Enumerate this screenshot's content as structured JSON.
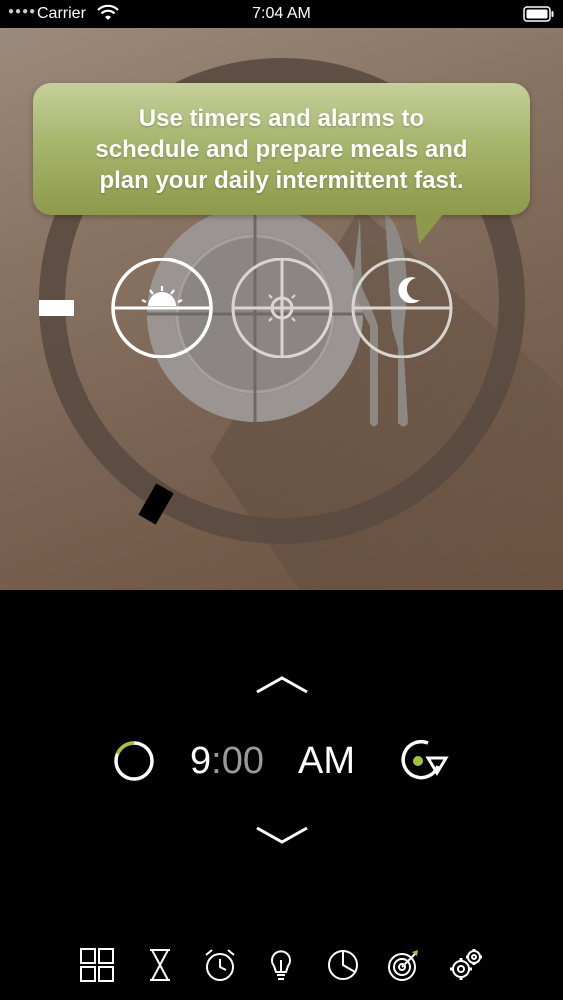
{
  "status_bar": {
    "carrier": "Carrier",
    "time": "7:04 AM",
    "signal_icon": "signal-dots-icon",
    "wifi_icon": "wifi-icon",
    "battery_icon": "battery-icon"
  },
  "hero": {
    "tooltip": "Use timers and alarms to\nschedule and prepare meals and\nplan your daily intermittent fast.",
    "meal_icons": [
      "sunrise-icon",
      "sun-icon",
      "moon-icon"
    ]
  },
  "time_picker": {
    "hour": "9",
    "separator": ":",
    "minutes": "00",
    "meridiem": "AM",
    "accent_color": "#a4c23c"
  },
  "tab_bar": {
    "tabs": [
      "grid-icon",
      "hourglass-icon",
      "alarm-clock-icon",
      "lightbulb-icon",
      "pie-chart-icon",
      "target-icon",
      "settings-icon"
    ]
  }
}
